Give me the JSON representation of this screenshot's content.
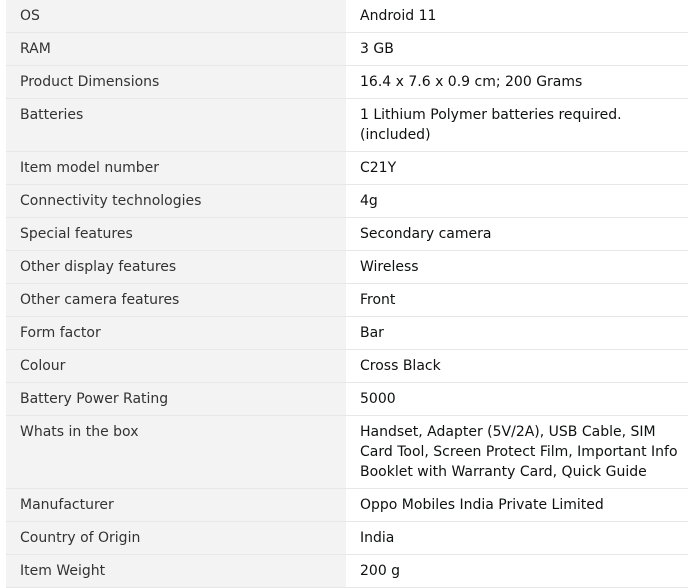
{
  "specs": [
    {
      "label": "OS",
      "value": "Android 11"
    },
    {
      "label": "RAM",
      "value": "3 GB"
    },
    {
      "label": "Product Dimensions",
      "value": "16.4 x 7.6 x 0.9 cm; 200 Grams"
    },
    {
      "label": "Batteries",
      "value": "1 Lithium Polymer batteries required. (included)"
    },
    {
      "label": "Item model number",
      "value": "C21Y"
    },
    {
      "label": "Connectivity technologies",
      "value": "4g"
    },
    {
      "label": "Special features",
      "value": "Secondary camera"
    },
    {
      "label": "Other display features",
      "value": "Wireless"
    },
    {
      "label": "Other camera features",
      "value": "Front"
    },
    {
      "label": "Form factor",
      "value": "Bar"
    },
    {
      "label": "Colour",
      "value": "Cross Black"
    },
    {
      "label": "Battery Power Rating",
      "value": "5000"
    },
    {
      "label": "Whats in the box",
      "value": "Handset, Adapter (5V/2A), USB Cable, SIM Card Tool, Screen Protect Film, Important Info Booklet with Warranty Card, Quick Guide"
    },
    {
      "label": "Manufacturer",
      "value": "Oppo Mobiles India Private Limited"
    },
    {
      "label": "Country of Origin",
      "value": "India"
    },
    {
      "label": "Item Weight",
      "value": "200 g"
    }
  ]
}
